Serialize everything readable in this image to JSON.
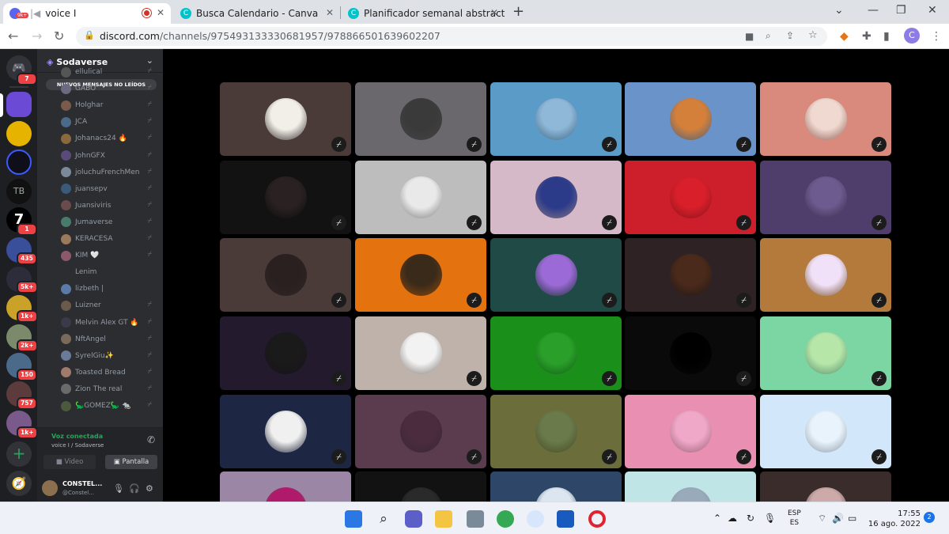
{
  "browser": {
    "tabs": [
      {
        "title": "voice I",
        "favicon_badge": "9k+",
        "recording": true
      },
      {
        "title": "Busca Calendario - Canva"
      },
      {
        "title": "Planificador semanal abstracto -"
      }
    ],
    "url_host": "discord.com",
    "url_path": "/channels/975493133330681957/978866501639602207",
    "profile_initial": "C"
  },
  "discord": {
    "home_badge": "7",
    "server_name": "Sodaverse",
    "new_messages_label": "NUEVOS MENSAJES NO LEÍDOS",
    "guild_badges": [
      "1",
      "435",
      "5k+",
      "1k+",
      "2k+",
      "150",
      "757",
      "1k+"
    ],
    "members": [
      {
        "name": "ellulical",
        "muted": true
      },
      {
        "name": "GABO",
        "muted": true
      },
      {
        "name": "Holghar",
        "muted": true
      },
      {
        "name": "JCA",
        "muted": true
      },
      {
        "name": "Johanacs24 🔥",
        "muted": true
      },
      {
        "name": "JohnGFX",
        "muted": true
      },
      {
        "name": "joluchuFrenchMen",
        "muted": true
      },
      {
        "name": "juansepv",
        "muted": true
      },
      {
        "name": "Juansiviris",
        "muted": true
      },
      {
        "name": "Jumaverse",
        "muted": true
      },
      {
        "name": "KERACESA",
        "muted": true
      },
      {
        "name": "KIM 🤍",
        "muted": true
      },
      {
        "name": "Lenim",
        "muted": false
      },
      {
        "name": "lizbeth |",
        "muted": false
      },
      {
        "name": "Luizner",
        "muted": true
      },
      {
        "name": "Melvin Alex GT 🔥",
        "muted": true
      },
      {
        "name": "NftAngel",
        "muted": true
      },
      {
        "name": "SyrelGiu✨",
        "muted": true
      },
      {
        "name": "Toasted Bread",
        "muted": true
      },
      {
        "name": "Zion The real",
        "muted": true
      },
      {
        "name": "🦕GOMEZ🦕 🐀",
        "muted": true
      }
    ],
    "voice": {
      "status": "Voz conectada",
      "channel": "voice I / Sodaverse",
      "video_label": "Video",
      "screen_label": "Pantalla"
    },
    "user": {
      "name": "CONSTEL...",
      "tag": "@Constel..."
    }
  },
  "colors": {
    "tile_colors": [
      "#4a3a38",
      "#6a686c",
      "#5a9bc7",
      "#6a93c9",
      "#d98a7c",
      "#121212",
      "#bdbdbd",
      "#d6b9c9",
      "#cc1f2b",
      "#4f3d6b",
      "#4a3a38",
      "#e3720f",
      "#1f4a46",
      "#2e2224",
      "#b47a3c",
      "#241a2e",
      "#bfb2ab",
      "#1a8f1a",
      "#0a0a0a",
      "#7bd6a4",
      "#1d2744",
      "#5a3c4e",
      "#6b6d3a",
      "#e88fb2",
      "#d2e8fa",
      "#9c86a6",
      "#121212",
      "#2e4668",
      "#bfe5e7",
      "#3a2c2a"
    ]
  },
  "taskbar": {
    "lang_top": "ESP",
    "lang_bottom": "ES",
    "time": "17:55",
    "date": "16 ago. 2022",
    "notifications": "2"
  }
}
